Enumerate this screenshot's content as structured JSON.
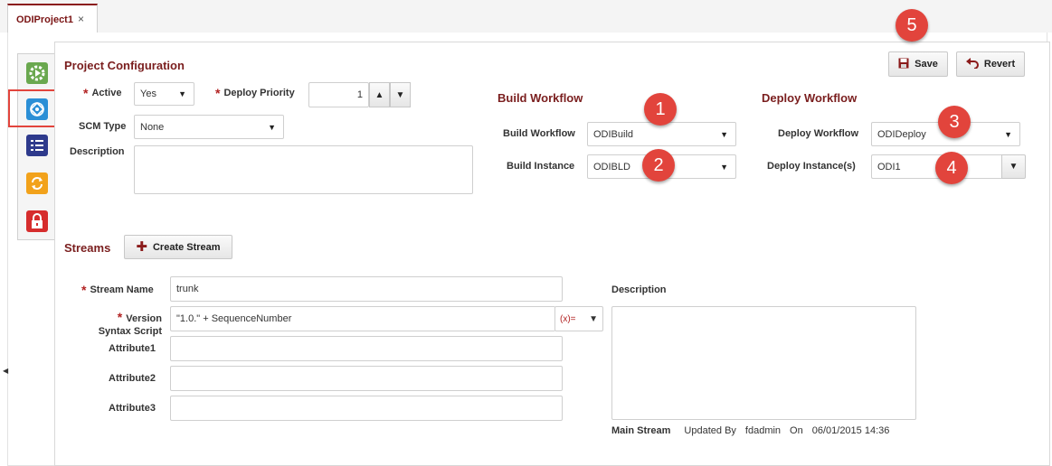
{
  "tab": {
    "title": "ODIProject1",
    "close": "×"
  },
  "project_config": {
    "heading": "Project Configuration",
    "active_label": "Active",
    "active_value": "Yes",
    "deploy_priority_label": "Deploy Priority",
    "deploy_priority_value": "1",
    "scm_type_label": "SCM Type",
    "scm_type_value": "None",
    "description_label": "Description"
  },
  "build_workflow": {
    "heading": "Build Workflow",
    "workflow_label": "Build Workflow",
    "workflow_value": "ODIBuild",
    "instance_label": "Build Instance",
    "instance_value": "ODIBLD"
  },
  "deploy_workflow": {
    "heading": "Deploy Workflow",
    "workflow_label": "Deploy Workflow",
    "workflow_value": "ODIDeploy",
    "instance_label": "Deploy Instance(s)",
    "instance_value": "ODI1"
  },
  "toolbar": {
    "save_label": "Save",
    "revert_label": "Revert"
  },
  "streams": {
    "heading": "Streams",
    "create_label": "Create Stream",
    "stream_name_label": "Stream Name",
    "stream_name_value": "trunk",
    "version_label_line1": "Version",
    "version_label_line2": "Syntax Script",
    "version_value": "\"1.0.\" + SequenceNumber",
    "expr_label": "(x)=",
    "attribute1_label": "Attribute1",
    "attribute2_label": "Attribute2",
    "attribute3_label": "Attribute3",
    "description_label": "Description",
    "main_stream_label": "Main Stream",
    "updated_by_label": "Updated By",
    "updated_by_value": "fdadmin",
    "on_label": "On",
    "on_value": "06/01/2015 14:36"
  },
  "callouts": [
    "1",
    "2",
    "3",
    "4",
    "5"
  ],
  "rail": [
    "play-gear-icon",
    "workflow-icon",
    "list-icon",
    "refresh-icon",
    "lock-icon"
  ],
  "colors": {
    "accent": "#7a1e1e",
    "callout": "#e2443c"
  }
}
